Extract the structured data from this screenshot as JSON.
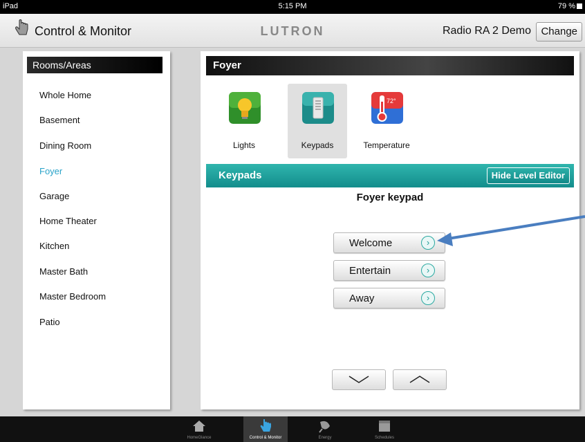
{
  "status": {
    "carrier": "iPad",
    "time": "5:15 PM",
    "battery": "79 %"
  },
  "topbar": {
    "title": "Control & Monitor",
    "logo": "LUTRON",
    "system": "Radio RA 2 Demo",
    "change": "Change"
  },
  "rooms": {
    "header": "Rooms/Areas",
    "items": [
      "Whole Home",
      "Basement",
      "Dining Room",
      "Foyer",
      "Garage",
      "Home Theater",
      "Kitchen",
      "Master Bath",
      "Master Bedroom",
      "Patio"
    ],
    "active": "Foyer"
  },
  "main": {
    "room_title": "Foyer",
    "categories": [
      {
        "label": "Lights",
        "icon": "lightbulb-icon"
      },
      {
        "label": "Keypads",
        "icon": "keypad-icon"
      },
      {
        "label": "Temperature",
        "icon": "thermometer-icon",
        "temp": "72°"
      }
    ],
    "section": "Keypads",
    "hide_editor": "Hide Level Editor",
    "keypad_name": "Foyer keypad",
    "buttons": [
      "Welcome",
      "Entertain",
      "Away"
    ]
  },
  "tabs": [
    "HomeGlance",
    "Control & Monitor",
    "Energy",
    "Schedules"
  ],
  "colors": {
    "accent": "#29a3c9",
    "teal": "#1f9e97",
    "annotation_arrow": "#4a7ec0"
  }
}
